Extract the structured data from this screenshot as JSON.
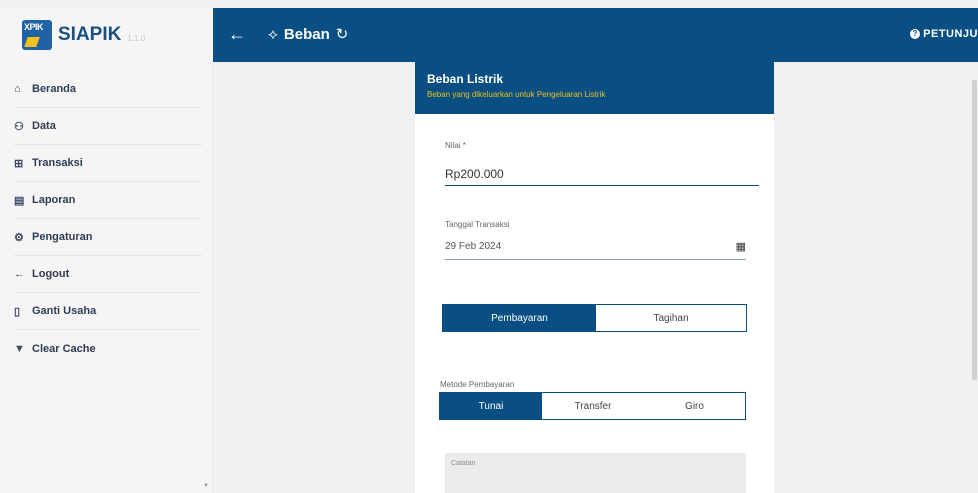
{
  "brand": {
    "name": "SIAPIK",
    "logo_text": "XPIK",
    "version": "1.1.0"
  },
  "header": {
    "title": "Beban",
    "help_label": "PETUNJU"
  },
  "sidebar": {
    "items": [
      {
        "label": "Beranda",
        "icon": "home-icon",
        "glyph": "⌂"
      },
      {
        "label": "Data",
        "icon": "users-icon",
        "glyph": "⚇"
      },
      {
        "label": "Transaksi",
        "icon": "cart-icon",
        "glyph": "⊞"
      },
      {
        "label": "Laporan",
        "icon": "report-icon",
        "glyph": "▤"
      },
      {
        "label": "Pengaturan",
        "icon": "gear-icon",
        "glyph": "⚙"
      },
      {
        "label": "Logout",
        "icon": "arrow-left-icon",
        "glyph": "←"
      },
      {
        "label": "Ganti Usaha",
        "icon": "document-icon",
        "glyph": "▯"
      },
      {
        "label": "Clear Cache",
        "icon": "trash-icon",
        "glyph": "▼"
      }
    ]
  },
  "form": {
    "title": "Beban Listrik",
    "subtitle": "Beban yang dikeluarkan untuk Pengeluaran Listrik",
    "nilai_label": "Nilai *",
    "nilai_value": "Rp200.000",
    "tanggal_label": "Tanggal Transaksi",
    "tanggal_value": "29 Feb 2024",
    "type_options": [
      "Pembayaran",
      "Tagihan"
    ],
    "type_selected": "Pembayaran",
    "metode_label": "Metode Pembayaran",
    "metode_options": [
      "Tunai",
      "Transfer",
      "Giro"
    ],
    "metode_selected": "Tunai",
    "catatan_placeholder": "Catatan"
  },
  "colors": {
    "primary": "#0a4f83",
    "accent": "#e9c01e",
    "sidebar_bg": "#f5f5f5"
  }
}
